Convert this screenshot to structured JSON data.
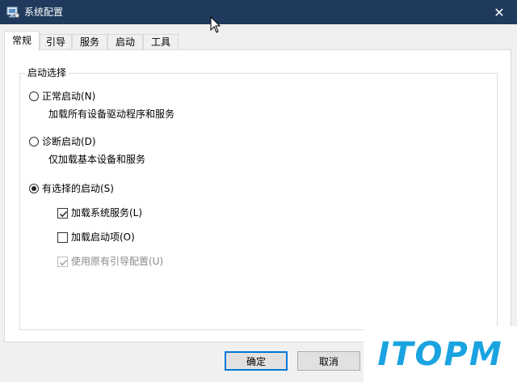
{
  "window": {
    "title": "系统配置",
    "close_glyph": "✕"
  },
  "tabs": [
    {
      "label": "常规",
      "active": true
    },
    {
      "label": "引导",
      "active": false
    },
    {
      "label": "服务",
      "active": false
    },
    {
      "label": "启动",
      "active": false
    },
    {
      "label": "工具",
      "active": false
    }
  ],
  "startup_selection": {
    "legend": "启动选择",
    "options": [
      {
        "label": "正常启动(N)",
        "description": "加载所有设备驱动程序和服务",
        "checked": false
      },
      {
        "label": "诊断启动(D)",
        "description": "仅加载基本设备和服务",
        "checked": false
      },
      {
        "label": "有选择的启动(S)",
        "checked": true
      }
    ],
    "selective": [
      {
        "label": "加载系统服务(L)",
        "checked": true,
        "enabled": true
      },
      {
        "label": "加载启动项(O)",
        "checked": false,
        "enabled": true
      },
      {
        "label": "使用原有引导配置(U)",
        "checked": true,
        "enabled": false
      }
    ]
  },
  "buttons": {
    "ok": "确定",
    "cancel": "取消"
  },
  "watermark": {
    "text": "ITOPM"
  },
  "colors": {
    "titlebar": "#1f3a5c",
    "accent": "#0078d7",
    "watermark": "#1aa3e0"
  }
}
